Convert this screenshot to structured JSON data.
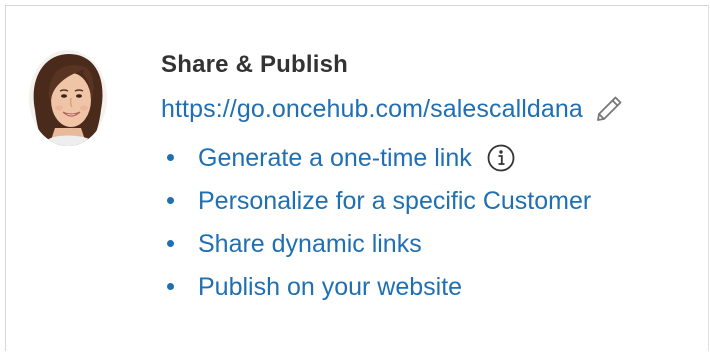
{
  "share_panel": {
    "title": "Share & Publish",
    "url": "https://go.oncehub.com/salescalldana",
    "edit_icon": "pencil-icon",
    "links": [
      {
        "label": "Generate a one-time link",
        "icon": "info-icon"
      },
      {
        "label": "Personalize for a specific Customer"
      },
      {
        "label": "Share dynamic links"
      },
      {
        "label": "Publish on your website"
      }
    ]
  },
  "colors": {
    "link": "#1f6fb2",
    "title": "#333333",
    "border": "#d6d6d6"
  }
}
